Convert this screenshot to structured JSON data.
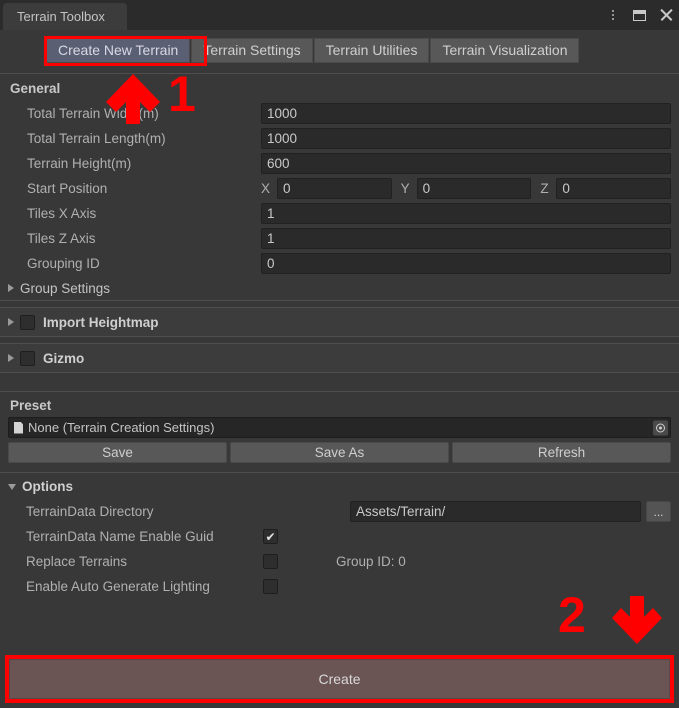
{
  "window": {
    "tab_title": "Terrain Toolbox",
    "controls": {
      "menu": "⋮",
      "maximize": "▣",
      "close": "✕"
    }
  },
  "toolbar": {
    "tabs": [
      {
        "label": "Create New Terrain",
        "active": true
      },
      {
        "label": "Terrain Settings",
        "active": false
      },
      {
        "label": "Terrain Utilities",
        "active": false
      },
      {
        "label": "Terrain Visualization",
        "active": false
      }
    ]
  },
  "general": {
    "title": "General",
    "fields": [
      {
        "label": "Total Terrain Width(m)",
        "value": "1000"
      },
      {
        "label": "Total Terrain Length(m)",
        "value": "1000"
      },
      {
        "label": "Terrain Height(m)",
        "value": "600"
      }
    ],
    "start_position": {
      "label": "Start Position",
      "x_axis": "X",
      "x_value": "0",
      "y_axis": "Y",
      "y_value": "0",
      "z_axis": "Z",
      "z_value": "0"
    },
    "tiles_x": {
      "label": "Tiles X Axis",
      "value": "1"
    },
    "tiles_z": {
      "label": "Tiles Z Axis",
      "value": "1"
    },
    "grouping_id": {
      "label": "Grouping ID",
      "value": "0"
    },
    "group_settings": {
      "label": "Group Settings"
    }
  },
  "import_heightmap": {
    "label": "Import Heightmap",
    "checked": false
  },
  "gizmo": {
    "label": "Gizmo",
    "checked": false
  },
  "preset": {
    "title": "Preset",
    "selected": "None (Terrain Creation Settings)",
    "buttons": {
      "save": "Save",
      "save_as": "Save As",
      "refresh": "Refresh"
    }
  },
  "options": {
    "title": "Options",
    "directory": {
      "label": "TerrainData Directory",
      "value": "Assets/Terrain/",
      "browse": "..."
    },
    "name_guid": {
      "label": "TerrainData Name Enable Guid",
      "checked": true
    },
    "replace_terrains": {
      "label": "Replace Terrains",
      "checked": false
    },
    "group_id_note": "Group ID: 0",
    "auto_lighting": {
      "label": "Enable Auto Generate Lighting",
      "checked": false
    }
  },
  "create": {
    "label": "Create"
  },
  "annotations": {
    "step1": "1",
    "step2": "2",
    "color": "#ff0000"
  }
}
